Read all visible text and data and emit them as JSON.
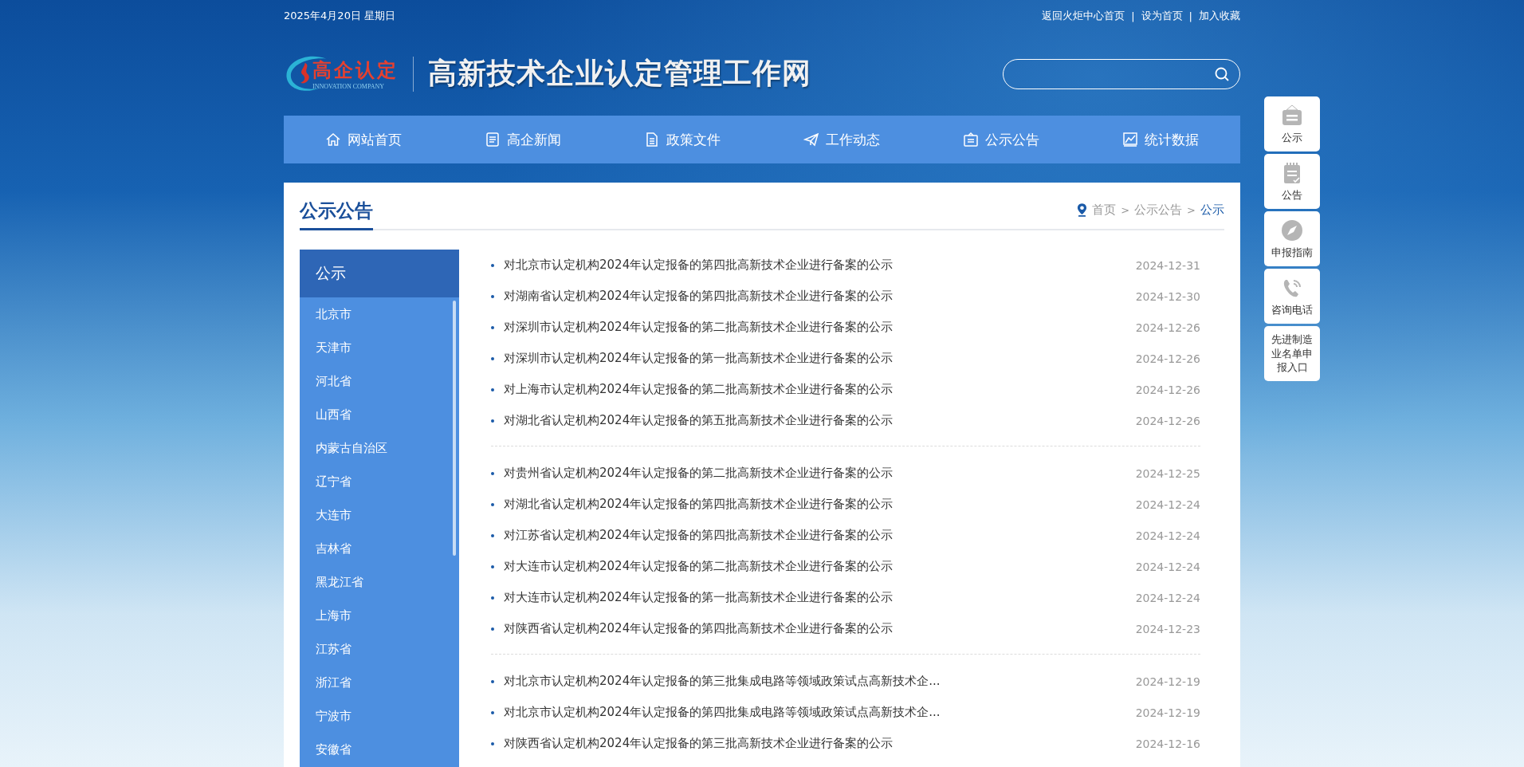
{
  "top_bar": {
    "date": "2025年4月20日 星期日",
    "links": [
      "返回火炬中心首页",
      "设为首页",
      "加入收藏"
    ],
    "separator": "|"
  },
  "logo": {
    "mark_text": "高企认定",
    "mark_subtext": "INNOVATION COMPANY",
    "site_title": "高新技术企业认定管理工作网"
  },
  "nav": [
    "网站首页",
    "高企新闻",
    "政策文件",
    "工作动态",
    "公示公告",
    "统计数据"
  ],
  "section": {
    "title": "公示公告",
    "breadcrumb": {
      "separator": ">",
      "items": [
        {
          "label": "首页",
          "current": false
        },
        {
          "label": "公示公告",
          "current": false
        },
        {
          "label": "公示",
          "current": true
        }
      ]
    }
  },
  "sidebar": {
    "title": "公示",
    "items": [
      "北京市",
      "天津市",
      "河北省",
      "山西省",
      "内蒙古自治区",
      "辽宁省",
      "大连市",
      "吉林省",
      "黑龙江省",
      "上海市",
      "江苏省",
      "浙江省",
      "宁波市",
      "安徽省"
    ]
  },
  "groups": [
    [
      {
        "title": "对北京市认定机构2024年认定报备的第四批高新技术企业进行备案的公示",
        "date": "2024-12-31"
      },
      {
        "title": "对湖南省认定机构2024年认定报备的第四批高新技术企业进行备案的公示",
        "date": "2024-12-30"
      },
      {
        "title": "对深圳市认定机构2024年认定报备的第二批高新技术企业进行备案的公示",
        "date": "2024-12-26"
      },
      {
        "title": "对深圳市认定机构2024年认定报备的第一批高新技术企业进行备案的公示",
        "date": "2024-12-26"
      },
      {
        "title": "对上海市认定机构2024年认定报备的第二批高新技术企业进行备案的公示",
        "date": "2024-12-26"
      },
      {
        "title": "对湖北省认定机构2024年认定报备的第五批高新技术企业进行备案的公示",
        "date": "2024-12-26"
      }
    ],
    [
      {
        "title": "对贵州省认定机构2024年认定报备的第二批高新技术企业进行备案的公示",
        "date": "2024-12-25"
      },
      {
        "title": "对湖北省认定机构2024年认定报备的第四批高新技术企业进行备案的公示",
        "date": "2024-12-24"
      },
      {
        "title": "对江苏省认定机构2024年认定报备的第四批高新技术企业进行备案的公示",
        "date": "2024-12-24"
      },
      {
        "title": "对大连市认定机构2024年认定报备的第二批高新技术企业进行备案的公示",
        "date": "2024-12-24"
      },
      {
        "title": "对大连市认定机构2024年认定报备的第一批高新技术企业进行备案的公示",
        "date": "2024-12-24"
      },
      {
        "title": "对陕西省认定机构2024年认定报备的第四批高新技术企业进行备案的公示",
        "date": "2024-12-23"
      }
    ],
    [
      {
        "title": "对北京市认定机构2024年认定报备的第三批集成电路等领域政策试点高新技术企...",
        "date": "2024-12-19"
      },
      {
        "title": "对北京市认定机构2024年认定报备的第四批集成电路等领域政策试点高新技术企...",
        "date": "2024-12-19"
      },
      {
        "title": "对陕西省认定机构2024年认定报备的第三批高新技术企业进行备案的公示",
        "date": "2024-12-16"
      }
    ]
  ],
  "float_menu": [
    "公示",
    "公告",
    "申报指南",
    "咨询电话",
    "先进制造业名单申报入口"
  ]
}
